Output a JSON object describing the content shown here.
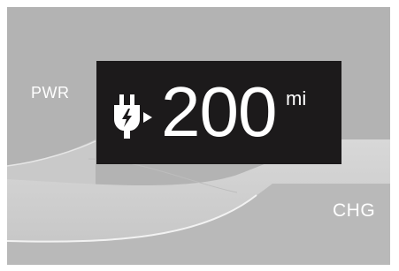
{
  "gauge": {
    "left_label": "PWR",
    "right_label": "CHG"
  },
  "range": {
    "value": "200",
    "unit": "mi",
    "icon": "ev-plug-charging-icon"
  },
  "colors": {
    "background": "#b5b5b5",
    "panel": "#1c1a1b",
    "text": "#ffffff"
  }
}
